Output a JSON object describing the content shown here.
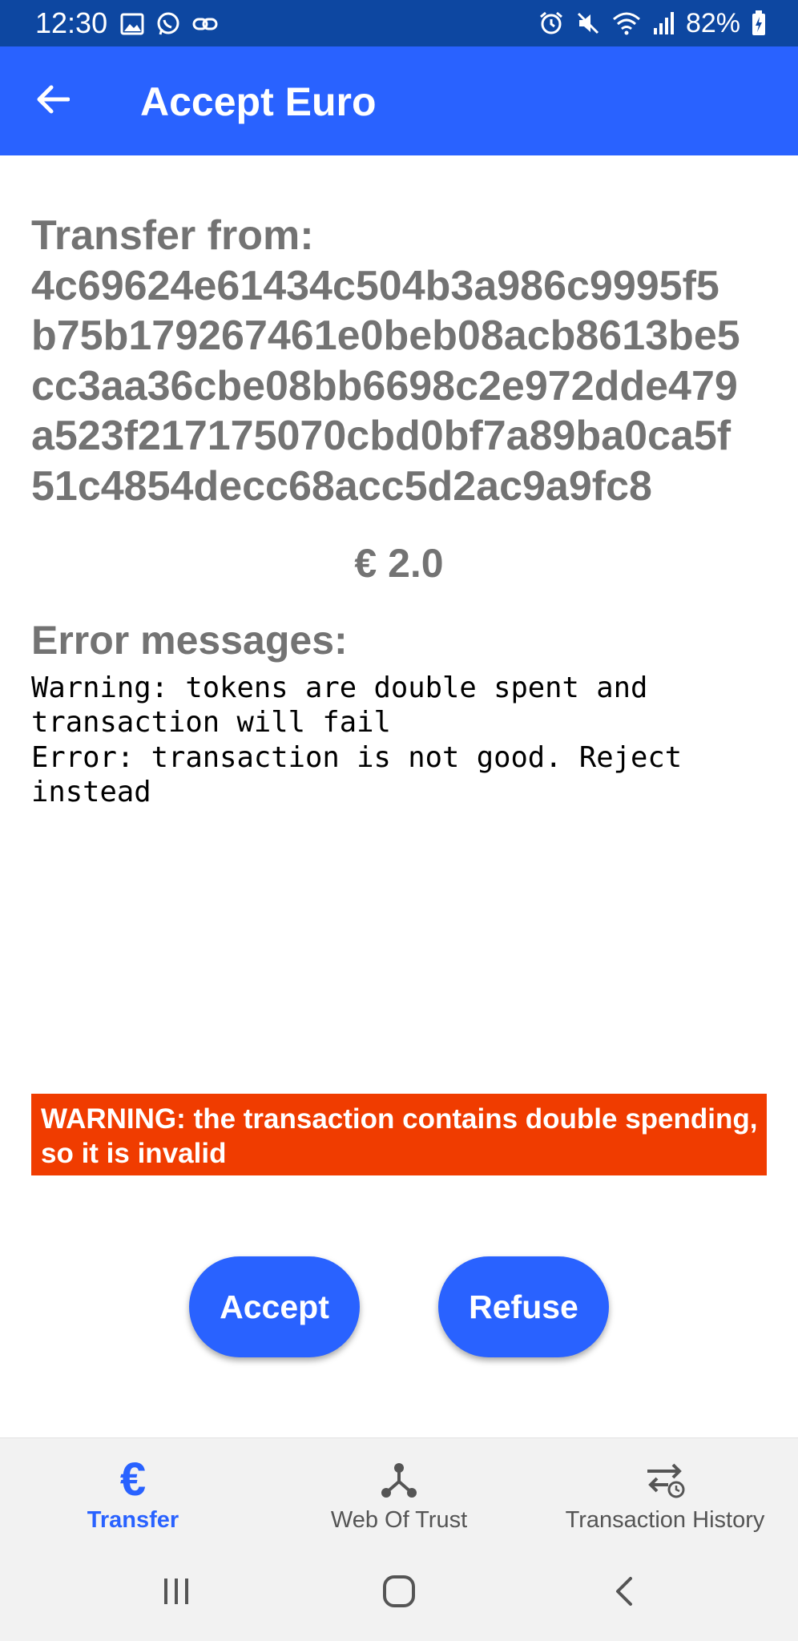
{
  "status_bar": {
    "time": "12:30",
    "battery": "82%",
    "left_icons": [
      "gallery-icon",
      "whatsapp-icon",
      "link-icon"
    ],
    "right_icons": [
      "alarm-icon",
      "mute-icon",
      "wifi-icon",
      "signal-icon",
      "battery-charging-icon"
    ]
  },
  "app_bar": {
    "title": "Accept Euro",
    "back_icon": "arrow-left-icon"
  },
  "transfer": {
    "label": "Transfer from:",
    "address_lines": [
      "4c69624e61434c504b3a986c9995f5",
      "b75b179267461e0beb08acb8613be5",
      "cc3aa36cbe08bb6698c2e972dde479",
      "a523f217175070cbd0bf7a89ba0ca5f",
      "51c4854decc68acc5d2ac9a9fc8"
    ]
  },
  "amount": "€ 2.0",
  "errors": {
    "heading": "Error messages:",
    "text": "Warning: tokens are double spent and\ntransaction will fail\nError: transaction is not good. Reject\ninstead"
  },
  "warning": {
    "text": "WARNING: the transaction contains double spending, so it is invalid",
    "background": "#f03c00"
  },
  "actions": {
    "accept_label": "Accept",
    "refuse_label": "Refuse"
  },
  "bottom_nav": {
    "items": [
      {
        "label": "Transfer",
        "icon": "euro-icon",
        "active": true
      },
      {
        "label": "Web Of Trust",
        "icon": "network-icon",
        "active": false
      },
      {
        "label": "Transaction History",
        "icon": "history-icon",
        "active": false
      }
    ]
  },
  "system_nav": {
    "buttons": [
      "recents-icon",
      "home-icon",
      "back-icon"
    ]
  },
  "colors": {
    "primary": "#2962ff",
    "status_bar": "#0d47a1",
    "text_gray": "#737373"
  }
}
